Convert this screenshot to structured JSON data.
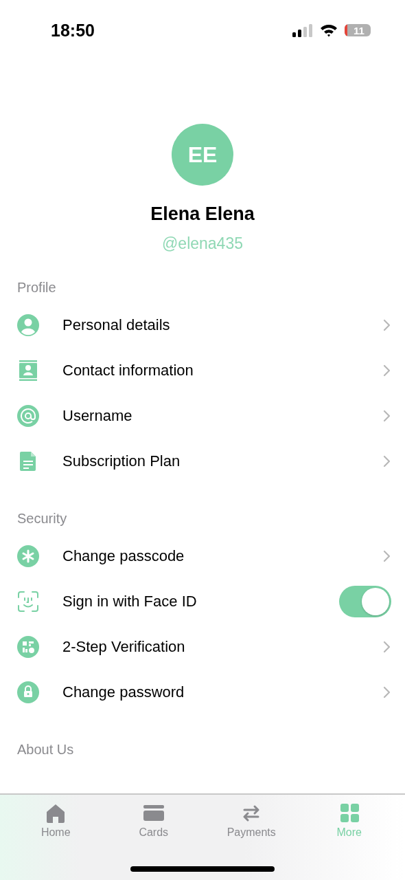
{
  "status_bar": {
    "time": "18:50",
    "battery": "11"
  },
  "profile": {
    "initials": "EE",
    "name": "Elena Elena",
    "username": "@elena435"
  },
  "sections": [
    {
      "title": "Profile",
      "items": [
        {
          "label": "Personal details",
          "kind": "link"
        },
        {
          "label": "Contact information",
          "kind": "link"
        },
        {
          "label": "Username",
          "kind": "link"
        },
        {
          "label": "Subscription Plan",
          "kind": "link"
        }
      ]
    },
    {
      "title": "Security",
      "items": [
        {
          "label": "Change passcode",
          "kind": "link"
        },
        {
          "label": "Sign in with Face ID",
          "kind": "toggle",
          "on": true
        },
        {
          "label": "2-Step Verification",
          "kind": "link"
        },
        {
          "label": "Change password",
          "kind": "link"
        }
      ]
    },
    {
      "title": "About Us"
    }
  ],
  "tab_bar": [
    {
      "label": "Home",
      "selected": false
    },
    {
      "label": "Cards",
      "selected": false
    },
    {
      "label": "Payments",
      "selected": false
    },
    {
      "label": "More",
      "selected": true
    }
  ]
}
